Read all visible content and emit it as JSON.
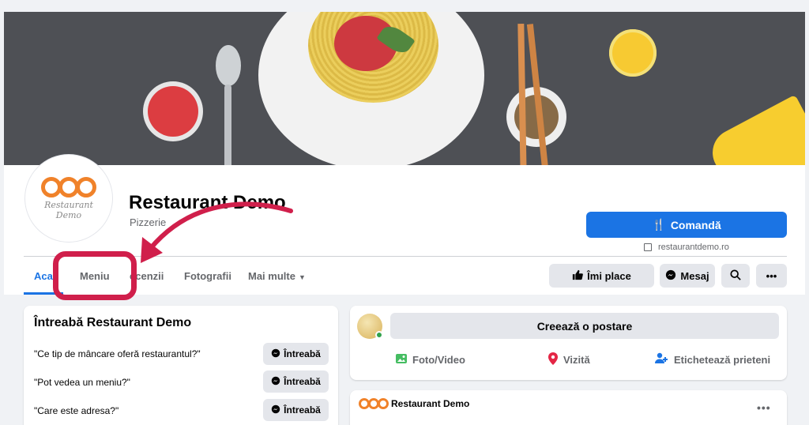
{
  "page": {
    "name": "Restaurant Demo",
    "category": "Pizzerie",
    "logo_text_line1": "Restaurant",
    "logo_text_line2": "Demo"
  },
  "cta": {
    "order_label": "Comandă",
    "website": "restaurantdemo.ro"
  },
  "tabs": [
    {
      "label": "Acas"
    },
    {
      "label": "Meniu"
    },
    {
      "label": "ecenzii"
    },
    {
      "label": "Fotografii"
    },
    {
      "label": "Mai multe"
    }
  ],
  "actions": {
    "like_label": "Îmi place",
    "message_label": "Mesaj"
  },
  "ask": {
    "title": "Întreabă Restaurant Demo",
    "button_label": "Întreabă",
    "questions": [
      "\"Ce tip de mâncare oferă restaurantul?\"",
      "\"Pot vedea un meniu?\"",
      "\"Care este adresa?\""
    ]
  },
  "composer": {
    "placeholder": "Creează o postare",
    "photo_label": "Foto/Video",
    "visit_label": "Vizită",
    "tag_label": "Etichetează prieteni"
  },
  "post": {
    "author": "Restaurant Demo"
  },
  "colors": {
    "brand_blue": "#1b74e4",
    "annotation_red": "#d01f4b",
    "logo_orange": "#f0822a"
  },
  "icons": [
    "cutlery-icon",
    "external-link-icon",
    "thumbs-up-icon",
    "messenger-icon",
    "search-icon",
    "more-icon",
    "photo-icon",
    "location-pin-icon",
    "tag-people-icon",
    "caret-down-icon"
  ]
}
